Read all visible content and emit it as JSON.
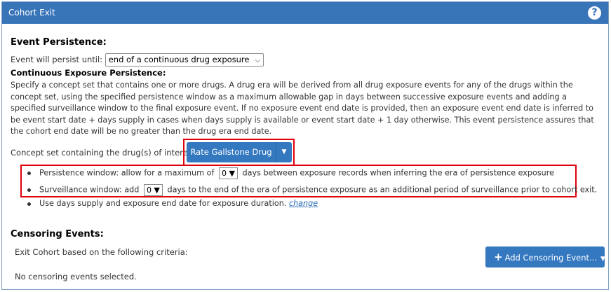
{
  "header": {
    "title": "Cohort Exit",
    "help_icon": "?"
  },
  "event_persistence": {
    "title": "Event Persistence:",
    "persist_label": "Event will persist until:",
    "persist_value": "end of a continuous drug exposure"
  },
  "continuous_exposure": {
    "title": "Continuous Exposure Persistence:",
    "description": "Specify a concept set that contains one or more drugs. A drug era will be derived from all drug exposure events for any of the drugs within the concept set, using the specified persistence window as a maximum allowable gap in days between successive exposure events and adding a specified surveillance window to the final exposure event. If no exposure event end date is provided, then an exposure event end date is inferred to be event start date + days supply in cases when days supply is available or event start date + 1 day otherwise. This event persistence assures that the cohort end date will be no greater than the drug era end date.",
    "concept_label": "Concept set containing the drug(s) of interest:",
    "concept_button": "Rate Gallstone Drug",
    "persistence_prefix": "Persistence window: allow for a maximum of",
    "persistence_value": "0",
    "persistence_suffix": "days between exposure records when inferring the era of persistence exposure",
    "surveillance_prefix": "Surveillance window: add",
    "surveillance_value": "0",
    "surveillance_suffix": "days to the end of the era of persistence exposure as an additional period of surveillance prior to cohort exit.",
    "days_supply_text": "Use days supply and exposure end date for exposure duration.",
    "change_link": "change"
  },
  "censoring": {
    "title": "Censoring Events:",
    "criteria_label": "Exit Cohort based on the following criteria:",
    "add_button": "Add Censoring Event...",
    "empty_text": "No censoring events selected."
  },
  "colors": {
    "header_bg": "#3874b8",
    "button_bg": "#3478c0",
    "highlight": "#e0000c",
    "link": "#2a6cb5"
  },
  "icons": {
    "help": "help-icon",
    "plus": "plus-icon",
    "caret": "caret-down-icon"
  }
}
